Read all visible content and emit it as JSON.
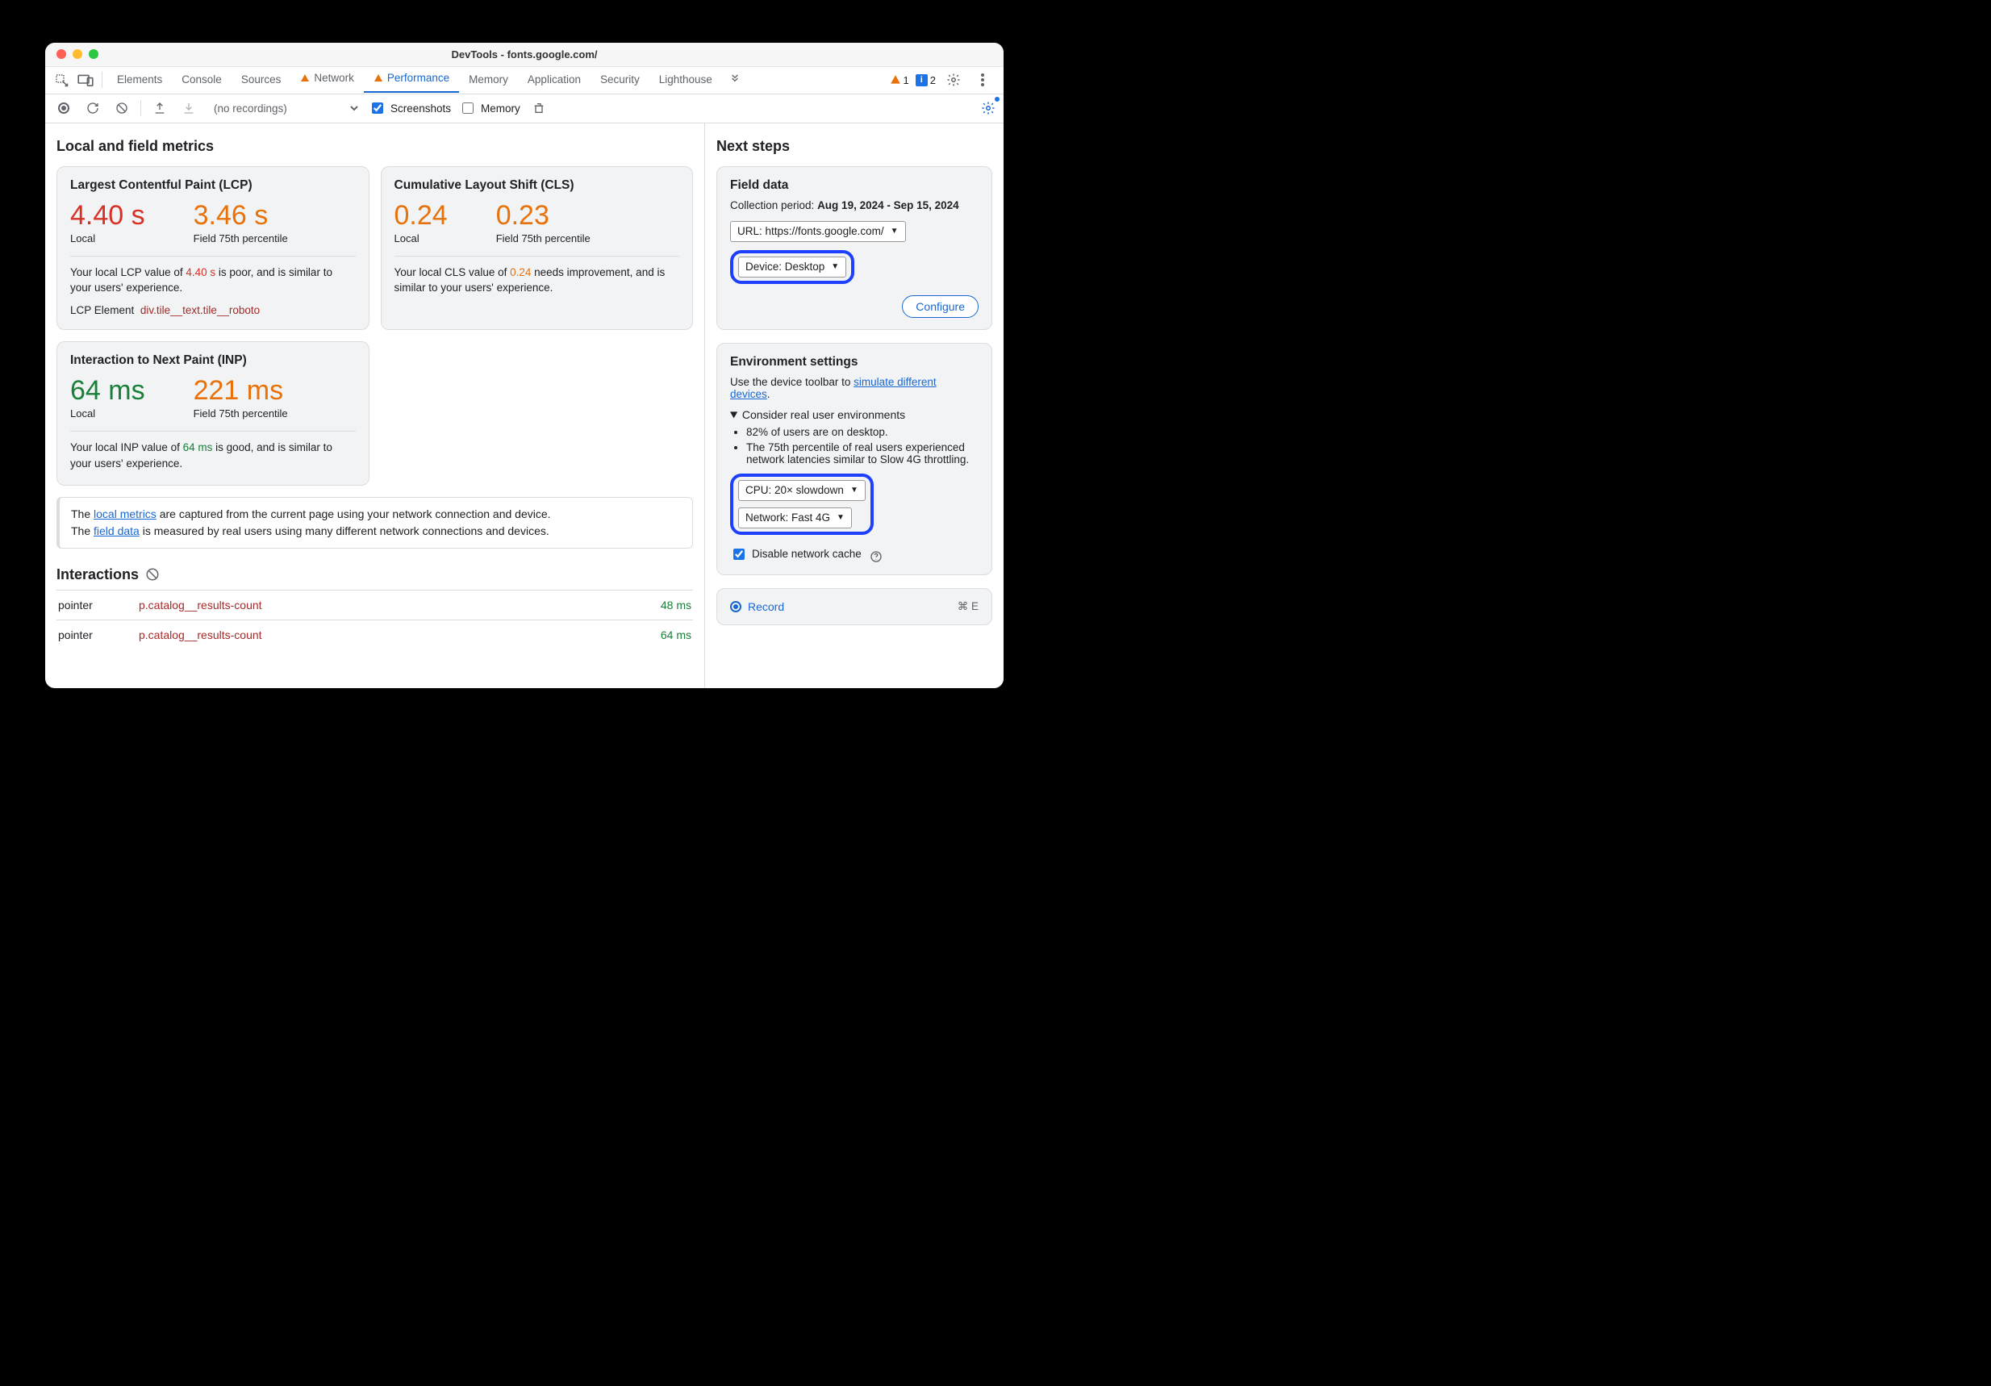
{
  "window_title": "DevTools - fonts.google.com/",
  "tabs": {
    "items": [
      "Elements",
      "Console",
      "Sources",
      "Network",
      "Performance",
      "Memory",
      "Application",
      "Security",
      "Lighthouse"
    ],
    "warn_index": [
      3,
      4
    ],
    "active_index": 4
  },
  "tabs_right": {
    "warn_count": "1",
    "info_count": "2"
  },
  "perf_toolbar": {
    "recordings_placeholder": "(no recordings)",
    "screenshots_label": "Screenshots",
    "screenshots_checked": true,
    "memory_label": "Memory",
    "memory_checked": false
  },
  "main": {
    "section_title": "Local and field metrics",
    "lcp": {
      "title": "Largest Contentful Paint (LCP)",
      "local_value": "4.40 s",
      "local_label": "Local",
      "field_value": "3.46 s",
      "field_label": "Field 75th percentile",
      "desc_pre": "Your local LCP value of ",
      "desc_val": "4.40 s",
      "desc_post": " is poor, and is similar to your users' experience.",
      "elem_label": "LCP Element",
      "elem_value": "div.tile__text.tile__roboto"
    },
    "cls": {
      "title": "Cumulative Layout Shift (CLS)",
      "local_value": "0.24",
      "local_label": "Local",
      "field_value": "0.23",
      "field_label": "Field 75th percentile",
      "desc_pre": "Your local CLS value of ",
      "desc_val": "0.24",
      "desc_post": " needs improvement, and is similar to your users' experience."
    },
    "inp": {
      "title": "Interaction to Next Paint (INP)",
      "local_value": "64 ms",
      "local_label": "Local",
      "field_value": "221 ms",
      "field_label": "Field 75th percentile",
      "desc_pre": "Your local INP value of ",
      "desc_val": "64 ms",
      "desc_post": " is good, and is similar to your users' experience."
    },
    "note": {
      "line1_pre": "The ",
      "line1_link": "local metrics",
      "line1_post": " are captured from the current page using your network connection and device.",
      "line2_pre": "The ",
      "line2_link": "field data",
      "line2_post": " is measured by real users using many different network connections and devices."
    },
    "interactions": {
      "title": "Interactions",
      "rows": [
        {
          "type": "pointer",
          "target": "p.catalog__results-count",
          "dur": "48 ms"
        },
        {
          "type": "pointer",
          "target": "p.catalog__results-count",
          "dur": "64 ms"
        }
      ]
    }
  },
  "side": {
    "title": "Next steps",
    "field_data": {
      "heading": "Field data",
      "period_label": "Collection period: ",
      "period_value": "Aug 19, 2024 - Sep 15, 2024",
      "url_select": "URL: https://fonts.google.com/",
      "device_select": "Device: Desktop",
      "configure_btn": "Configure"
    },
    "env": {
      "heading": "Environment settings",
      "hint_pre": "Use the device toolbar to ",
      "hint_link": "simulate different devices",
      "hint_post": ".",
      "consider": "Consider real user environments",
      "bullets": [
        "82% of users are on desktop.",
        "The 75th percentile of real users experienced network latencies similar to Slow 4G throttling."
      ],
      "cpu_select": "CPU: 20× slowdown",
      "net_select": "Network: Fast 4G",
      "disable_cache_label": "Disable network cache",
      "disable_cache_checked": true
    },
    "record": {
      "label": "Record",
      "shortcut": "⌘ E"
    }
  }
}
